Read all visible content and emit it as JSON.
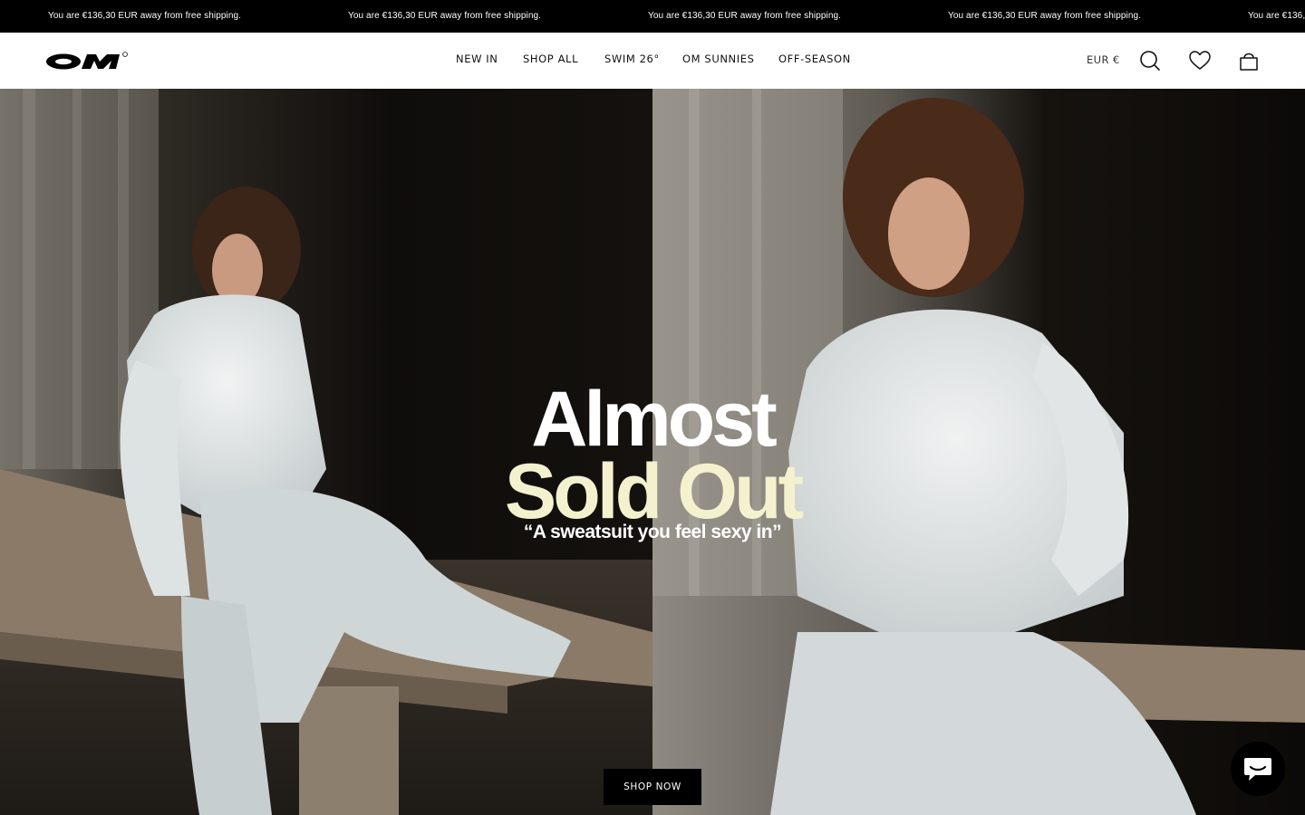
{
  "announcement": {
    "messages": [
      "You are €136,30 EUR away from free shipping.",
      "You are €136,30 EUR away from free shipping.",
      "You are €136,30 EUR away from free shipping.",
      "You are €136,30 EUR away from free shipping.",
      "You are €136,3"
    ]
  },
  "header": {
    "logo_text": "OM",
    "nav": [
      "NEW IN",
      "SHOP ALL",
      "SWIM 26°",
      "OM SUNNIES",
      "OFF-SEASON"
    ],
    "currency": "EUR €",
    "icons": [
      "search-icon",
      "heart-icon",
      "bag-icon"
    ]
  },
  "hero": {
    "headline_line1": "Almost",
    "headline_line2": "Sold Out",
    "quote": "“A sweatsuit you feel sexy in”",
    "cta_label": "SHOP NOW",
    "colors": {
      "headline_white": "#ffffff",
      "headline_cream": "#f4f1cf",
      "button_bg": "#000000"
    }
  },
  "chat": {
    "icon": "chat-bubble-icon"
  }
}
